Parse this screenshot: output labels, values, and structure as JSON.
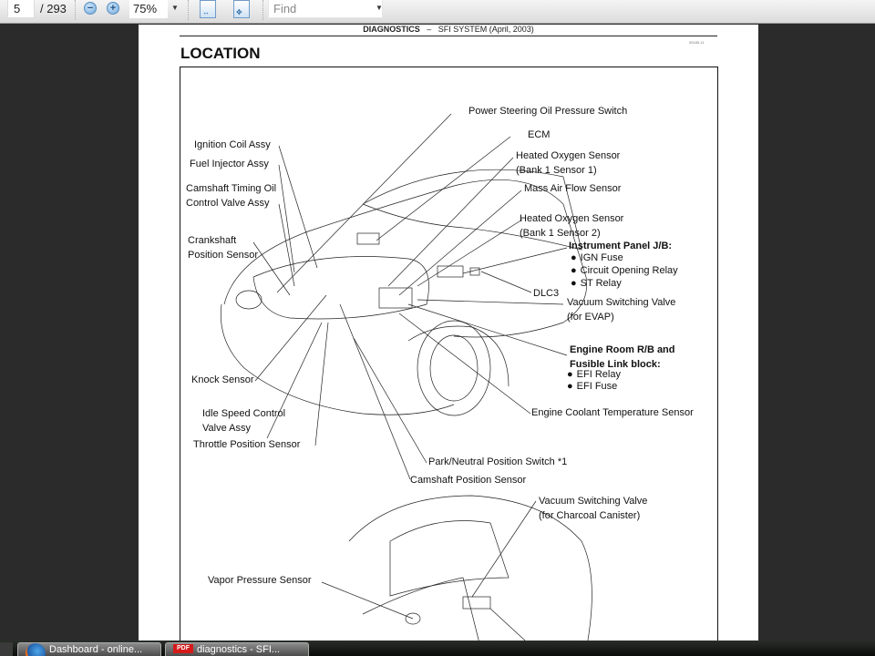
{
  "toolbar": {
    "page_current": "5",
    "page_total": "/ 293",
    "zoom_out_icon": "zoom-out-icon",
    "zoom_in_icon": "zoom-in-icon",
    "zoom_level": "75%",
    "fit_width_icon": "fit-width-icon",
    "fit_page_icon": "fit-page-icon",
    "find_placeholder": "Find"
  },
  "document": {
    "running_header_bold": "DIAGNOSTICS",
    "running_header_dash": "–",
    "running_header_rest": "SFI SYSTEM (April, 2003)",
    "doc_id": "05185-11",
    "section_title": "LOCATION",
    "labels": {
      "power_steering": "Power Steering Oil Pressure Switch",
      "ecm": "ECM",
      "ho2s_1_line1": "Heated Oxygen Sensor",
      "ho2s_1_line2": "(Bank 1 Sensor 1)",
      "maf": "Mass Air Flow Sensor",
      "ho2s_2_line1": "Heated Oxygen Sensor",
      "ho2s_2_line2": "(Bank 1 Sensor 2)",
      "ip_jb": "Instrument Panel J/B:",
      "ip_jb_items": [
        "IGN Fuse",
        "Circuit Opening Relay",
        "ST Relay"
      ],
      "dlc3": "DLC3",
      "vsv_evap_line1": "Vacuum Switching Valve",
      "vsv_evap_line2": "(for EVAP)",
      "er_rb_line1": "Engine Room R/B and",
      "er_rb_line2": "Fusible Link block:",
      "er_rb_items": [
        "EFI Relay",
        "EFI Fuse"
      ],
      "ect": "Engine Coolant Temperature Sensor",
      "ignition_coil": "Ignition Coil Assy",
      "fuel_injector": "Fuel Injector Assy",
      "camshaft_timing_line1": "Camshaft Timing Oil",
      "camshaft_timing_line2": "Control Valve Assy",
      "crankshaft_line1": "Crankshaft",
      "crankshaft_line2": "Position Sensor",
      "knock": "Knock Sensor",
      "isc_line1": "Idle Speed Control",
      "isc_line2": "Valve Assy",
      "tps": "Throttle Position Sensor",
      "pnp": "Park/Neutral Position Switch *1",
      "cmp": "Camshaft Position Sensor",
      "vsv_canister_line1": "Vacuum Switching Valve",
      "vsv_canister_line2": "(for Charcoal Canister)",
      "vapor": "Vapor Pressure Sensor"
    }
  },
  "taskbar": {
    "tasks": [
      {
        "label": "Dashboard - online...",
        "icon": "firefox-icon"
      },
      {
        "label": "diagnostics - SFI...",
        "icon": "pdf-icon"
      }
    ]
  }
}
